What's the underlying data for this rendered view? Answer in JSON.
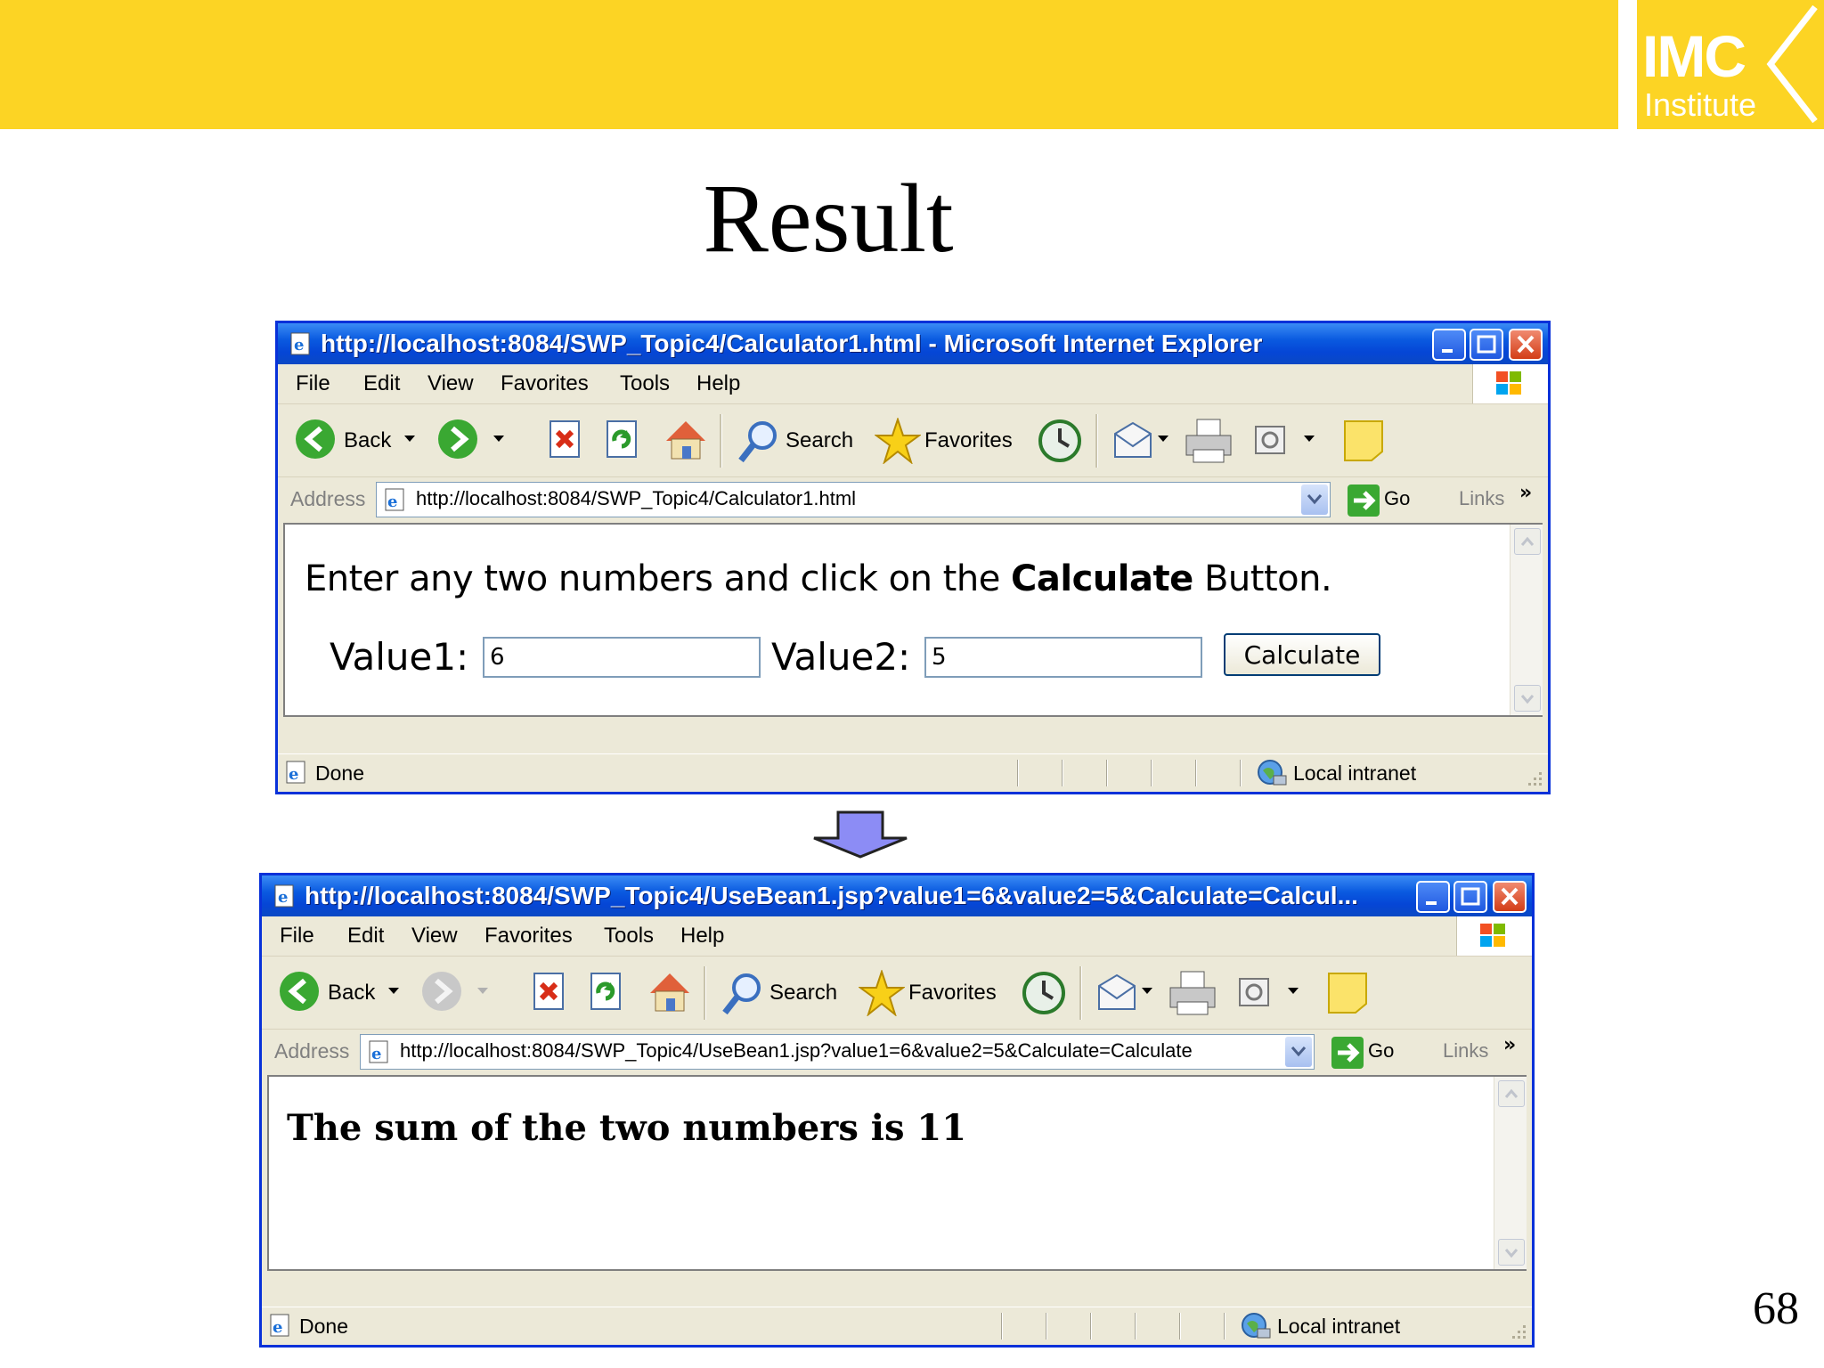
{
  "slide": {
    "title": "Result",
    "page_number": "68",
    "logo": {
      "line1": "IMC",
      "line2": "Institute"
    },
    "colors": {
      "top_bar": "#fcd424",
      "window_border": "#0831d9",
      "arrow": "#8c8cf5"
    }
  },
  "window1": {
    "title": "http://localhost:8084/SWP_Topic4/Calculator1.html - Microsoft Internet Explorer",
    "menu": [
      "File",
      "Edit",
      "View",
      "Favorites",
      "Tools",
      "Help"
    ],
    "toolbar": {
      "back": "Back",
      "search": "Search",
      "favorites": "Favorites"
    },
    "address": {
      "label": "Address",
      "url": "http://localhost:8084/SWP_Topic4/Calculator1.html",
      "go": "Go",
      "links": "Links"
    },
    "page": {
      "instruction_pre": "Enter any two numbers and click on the ",
      "instruction_bold": "Calculate",
      "instruction_post": " Button.",
      "value1_label": "Value1:",
      "value1": "6",
      "value2_label": "Value2:",
      "value2": "5",
      "button": "Calculate"
    },
    "status": {
      "text": "Done",
      "zone": "Local intranet"
    }
  },
  "window2": {
    "title": "http://localhost:8084/SWP_Topic4/UseBean1.jsp?value1=6&value2=5&Calculate=Calcul...",
    "menu": [
      "File",
      "Edit",
      "View",
      "Favorites",
      "Tools",
      "Help"
    ],
    "toolbar": {
      "back": "Back",
      "search": "Search",
      "favorites": "Favorites"
    },
    "address": {
      "label": "Address",
      "url": "http://localhost:8084/SWP_Topic4/UseBean1.jsp?value1=6&value2=5&Calculate=Calculate",
      "go": "Go",
      "links": "Links"
    },
    "page": {
      "result": "The sum of the two numbers is 11"
    },
    "status": {
      "text": "Done",
      "zone": "Local intranet"
    }
  }
}
